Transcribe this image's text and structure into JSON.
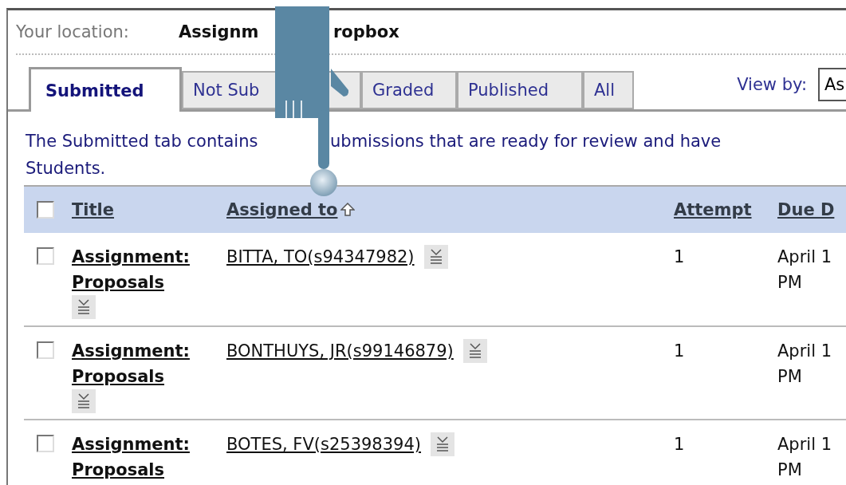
{
  "location": {
    "label": "Your location:",
    "value_parts": [
      "Assignm",
      "ropbox"
    ]
  },
  "tabs": [
    {
      "label": "Submitted",
      "selected": true
    },
    {
      "label": "Not Sub",
      "selected": false
    },
    {
      "label": "Graded",
      "selected": false
    },
    {
      "label": "Published",
      "selected": false
    },
    {
      "label": "All",
      "selected": false
    }
  ],
  "view_by": {
    "label": "View by:",
    "value": "As"
  },
  "description": {
    "line_1_parts": [
      "The Submitted tab contains",
      "ubmissions that are ready for review and have"
    ],
    "line_2": "Students."
  },
  "table": {
    "select_all_checked": false,
    "columns": [
      {
        "label": "Title",
        "sorted": false
      },
      {
        "label": "Assigned to",
        "sorted": true
      },
      {
        "label": "Attempt",
        "sorted": false
      },
      {
        "label": "Due D",
        "sorted": false
      }
    ],
    "rows": [
      {
        "checked": false,
        "title_prefix": "Assignment:",
        "title": "Proposals",
        "title_menu": true,
        "assigned_to": "BITTA, TO(s94347982)",
        "attempt": "1",
        "due": [
          "April 1",
          "PM"
        ]
      },
      {
        "checked": false,
        "title_prefix": "Assignment:",
        "title": "Proposals",
        "title_menu": true,
        "assigned_to": "BONTHUYS, JR(s99146879)",
        "attempt": "1",
        "due": [
          "April 1",
          "PM"
        ]
      },
      {
        "checked": false,
        "title_prefix": "Assignment:",
        "title": "Proposals",
        "title_menu": false,
        "assigned_to": "BOTES, FV(s25398394)",
        "attempt": "1",
        "due": [
          "April 1",
          "PM"
        ]
      }
    ]
  }
}
